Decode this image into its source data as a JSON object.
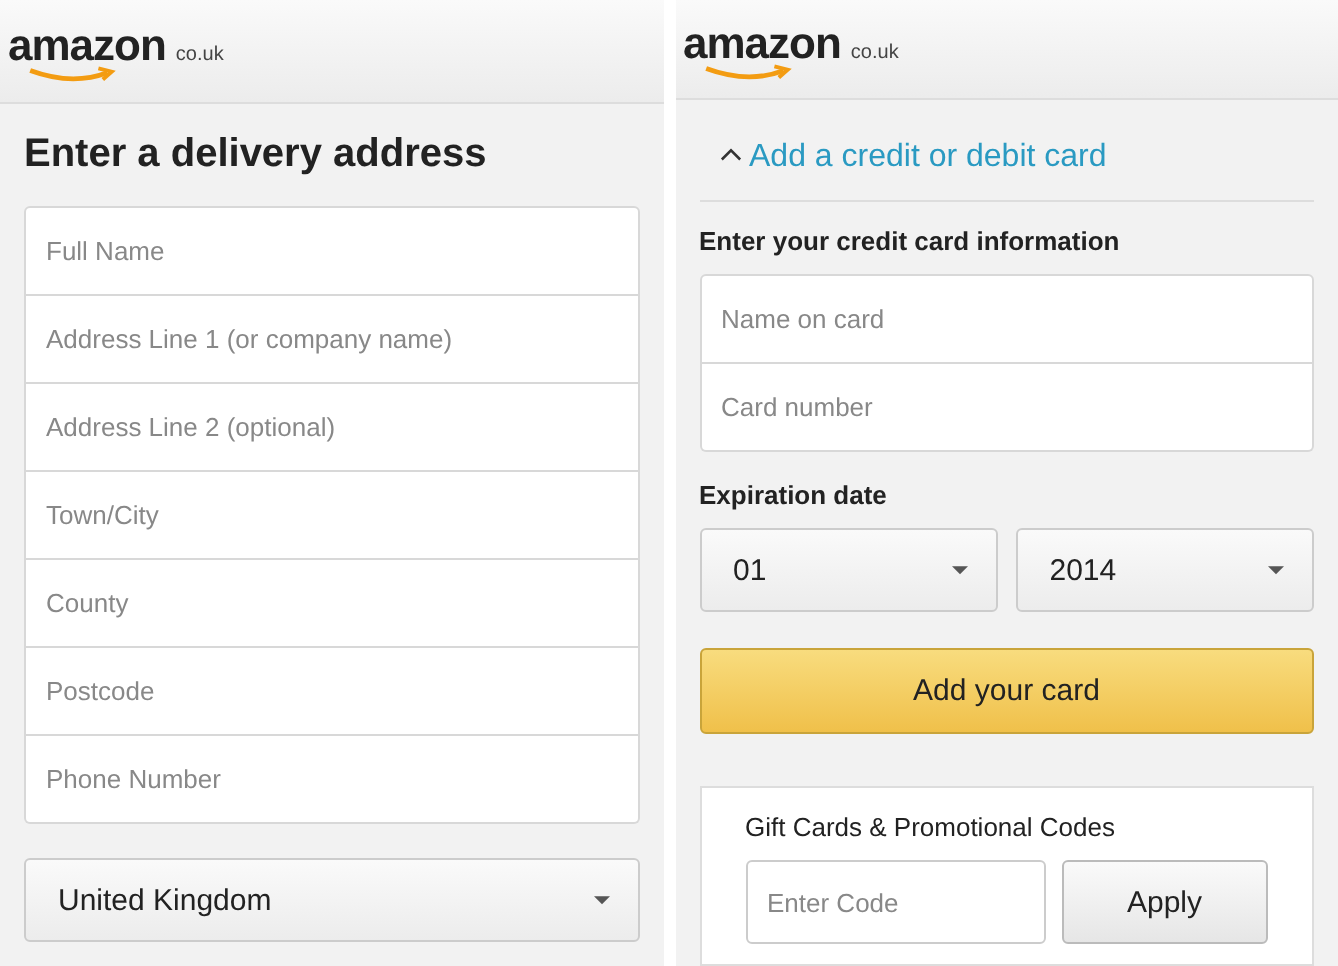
{
  "screens": [
    {
      "logo": {
        "name": "amazon",
        "domain": "co.uk"
      },
      "title": "Enter a delivery address",
      "fields": [
        {
          "placeholder": "Full Name"
        },
        {
          "placeholder": "Address Line 1 (or company name)"
        },
        {
          "placeholder": "Address Line 2 (optional)"
        },
        {
          "placeholder": "Town/City"
        },
        {
          "placeholder": "County"
        },
        {
          "placeholder": "Postcode"
        },
        {
          "placeholder": "Phone Number"
        }
      ],
      "country": "United Kingdom"
    },
    {
      "logo": {
        "name": "amazon",
        "domain": "co.uk"
      },
      "section": {
        "label": "Add a credit or debit card",
        "expanded": true
      },
      "card_heading": "Enter your credit card information",
      "fields": [
        {
          "placeholder": "Name on card"
        },
        {
          "placeholder": "Card number"
        }
      ],
      "expiry_label": "Expiration date",
      "expiry_month": "01",
      "expiry_year": "2014",
      "submit": "Add your card",
      "gift": {
        "label": "Gift Cards & Promotional Codes",
        "placeholder": "Enter Code",
        "button": "Apply"
      }
    }
  ]
}
